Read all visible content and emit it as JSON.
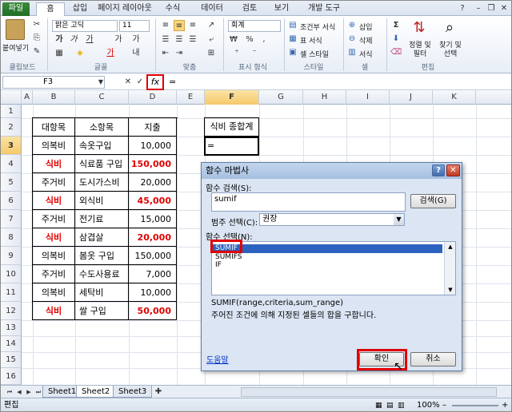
{
  "tabs": [
    "파일",
    "홈",
    "삽입",
    "페이지 레이아웃",
    "수식",
    "데이터",
    "검토",
    "보기",
    "개발 도구"
  ],
  "ribbon": {
    "paste": "붙여넣기",
    "font_name": "맑은 고딕",
    "font_size": "11",
    "number_format": "회계",
    "cond_format": "조건부 서식",
    "table_format": "표 서식",
    "cell_style": "셀 스타일",
    "insert": "삽입",
    "delete": "삭제",
    "format": "서식",
    "sort_filter": "정렬 및 필터",
    "find_select": "찾기 및 선택",
    "groups": [
      "클립보드",
      "글꼴",
      "맞춤",
      "표시 형식",
      "스타일",
      "셀",
      "편집"
    ]
  },
  "formula_bar": {
    "name_box": "F3",
    "fx": "fx",
    "content": "="
  },
  "columns": [
    "A",
    "B",
    "C",
    "D",
    "E",
    "F",
    "G",
    "H",
    "I",
    "J",
    "K"
  ],
  "rows": [
    "1",
    "2",
    "3",
    "4",
    "5",
    "6",
    "7",
    "8",
    "9",
    "10",
    "11",
    "12",
    "13",
    "14",
    "15",
    "16"
  ],
  "table": {
    "headers": [
      "대항목",
      "소항목",
      "지출"
    ],
    "rows": [
      {
        "cat": "의복비",
        "sub": "속옷구입",
        "amt": "10,000",
        "hl": false
      },
      {
        "cat": "식비",
        "sub": "식료품 구입",
        "amt": "150,000",
        "hl": true
      },
      {
        "cat": "주거비",
        "sub": "도시가스비",
        "amt": "20,000",
        "hl": false
      },
      {
        "cat": "식비",
        "sub": "외식비",
        "amt": "45,000",
        "hl": true
      },
      {
        "cat": "주거비",
        "sub": "전기료",
        "amt": "15,000",
        "hl": false
      },
      {
        "cat": "식비",
        "sub": "삼겹살",
        "amt": "20,000",
        "hl": true
      },
      {
        "cat": "의복비",
        "sub": "봄옷 구입",
        "amt": "150,000",
        "hl": false
      },
      {
        "cat": "주거비",
        "sub": "수도사용료",
        "amt": "7,000",
        "hl": false
      },
      {
        "cat": "의복비",
        "sub": "세탁비",
        "amt": "10,000",
        "hl": false
      },
      {
        "cat": "식비",
        "sub": "쌀 구입",
        "amt": "50,000",
        "hl": true
      }
    ]
  },
  "summary": {
    "header": "식비 종합계",
    "value": "="
  },
  "dialog": {
    "title": "함수 마법사",
    "search_label": "함수 검색(S):",
    "search_value": "sumif",
    "search_button": "검색(G)",
    "category_label": "범주 선택(C):",
    "category_value": "권장",
    "list_label": "함수 선택(N):",
    "functions": [
      "SUMIF",
      "SUMIFS",
      "IF"
    ],
    "syntax": "SUMIF(range,criteria,sum_range)",
    "description": "주어진 조건에 의해 지정된 셀들의 합을 구합니다.",
    "help_link": "도움말",
    "ok": "확인",
    "cancel": "취소"
  },
  "sheets": [
    "Sheet1",
    "Sheet2",
    "Sheet3"
  ],
  "status": {
    "mode": "편집",
    "zoom": "100%"
  }
}
